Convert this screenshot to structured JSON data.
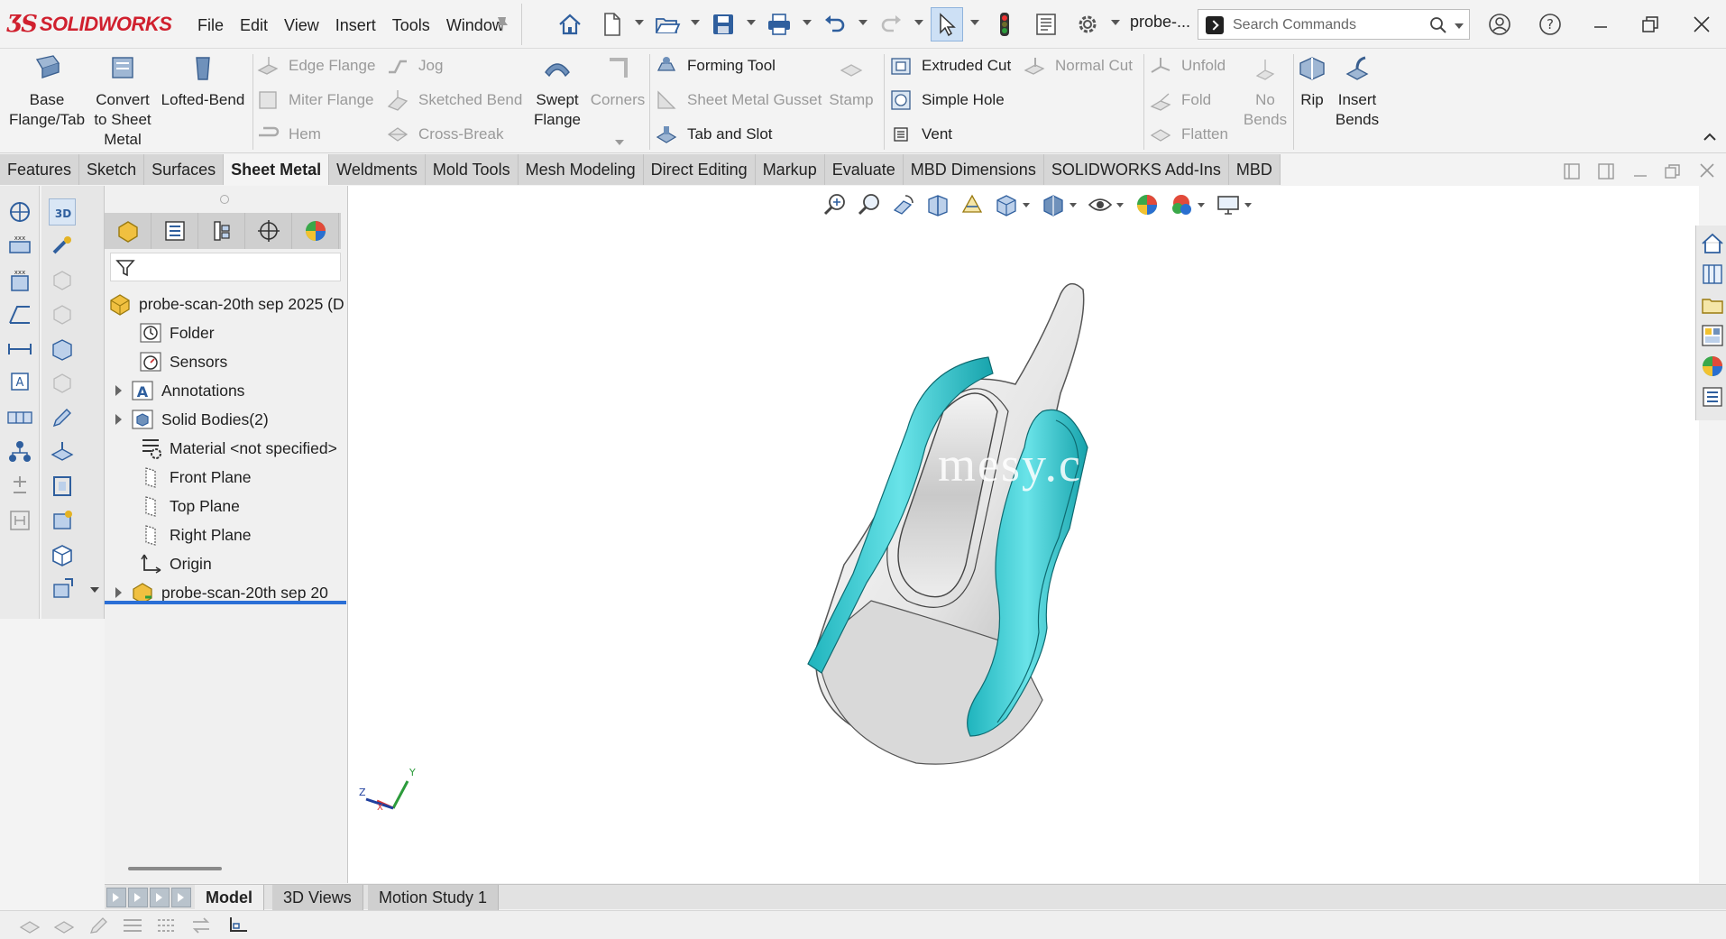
{
  "app": {
    "name": "SOLIDWORKS",
    "doc_title_short": "probe-...",
    "search_placeholder": "Search Commands",
    "menus": [
      "File",
      "Edit",
      "View",
      "Insert",
      "Tools",
      "Window"
    ]
  },
  "ribbon": {
    "big_buttons": [
      {
        "label": "Base\nFlange/Tab",
        "disabled": false
      },
      {
        "label": "Convert\nto Sheet\nMetal",
        "disabled": false
      },
      {
        "label": "Lofted-Bend",
        "disabled": false
      },
      {
        "label": "Swept\nFlange",
        "disabled": false
      },
      {
        "label": "Corners",
        "disabled": true
      },
      {
        "label": "Stamp",
        "disabled": true
      },
      {
        "label": "No\nBends",
        "disabled": true
      },
      {
        "label": "Rip",
        "disabled": false
      },
      {
        "label": "Insert\nBends",
        "disabled": false
      }
    ],
    "small_buttons": {
      "edge_flange": "Edge Flange",
      "miter_flange": "Miter Flange",
      "hem": "Hem",
      "jog": "Jog",
      "sketched_bend": "Sketched Bend",
      "cross_break": "Cross-Break",
      "forming_tool": "Forming Tool",
      "sheet_metal_gusset": "Sheet Metal Gusset",
      "tab_and_slot": "Tab and Slot",
      "extruded_cut": "Extruded Cut",
      "simple_hole": "Simple Hole",
      "vent": "Vent",
      "normal_cut": "Normal Cut",
      "unfold": "Unfold",
      "fold": "Fold",
      "flatten": "Flatten"
    }
  },
  "tabs": [
    "Features",
    "Sketch",
    "Surfaces",
    "Sheet Metal",
    "Weldments",
    "Mold Tools",
    "Mesh Modeling",
    "Direct Editing",
    "Markup",
    "Evaluate",
    "MBD Dimensions",
    "SOLIDWORKS Add-Ins",
    "MBD"
  ],
  "active_tab": "Sheet Metal",
  "feature_tree": {
    "root": "probe-scan-20th sep 2025 (D",
    "items": [
      {
        "label": "Folder",
        "expandable": false
      },
      {
        "label": "Sensors",
        "expandable": false
      },
      {
        "label": "Annotations",
        "expandable": true
      },
      {
        "label": "Solid Bodies(2)",
        "expandable": true
      },
      {
        "label": "Material <not specified>",
        "expandable": false
      },
      {
        "label": "Front Plane",
        "expandable": false
      },
      {
        "label": "Top Plane",
        "expandable": false
      },
      {
        "label": "Right Plane",
        "expandable": false
      },
      {
        "label": "Origin",
        "expandable": false
      },
      {
        "label": "probe-scan-20th sep 20",
        "expandable": true
      }
    ]
  },
  "viewport": {
    "watermark": "mesy.com",
    "triad": {
      "x": "X",
      "y": "Y",
      "z": "Z"
    },
    "accent_color": "#2ec4cc"
  },
  "bottom_tabs": [
    "Model",
    "3D Views",
    "Motion Study 1"
  ],
  "active_bottom_tab": "Model"
}
